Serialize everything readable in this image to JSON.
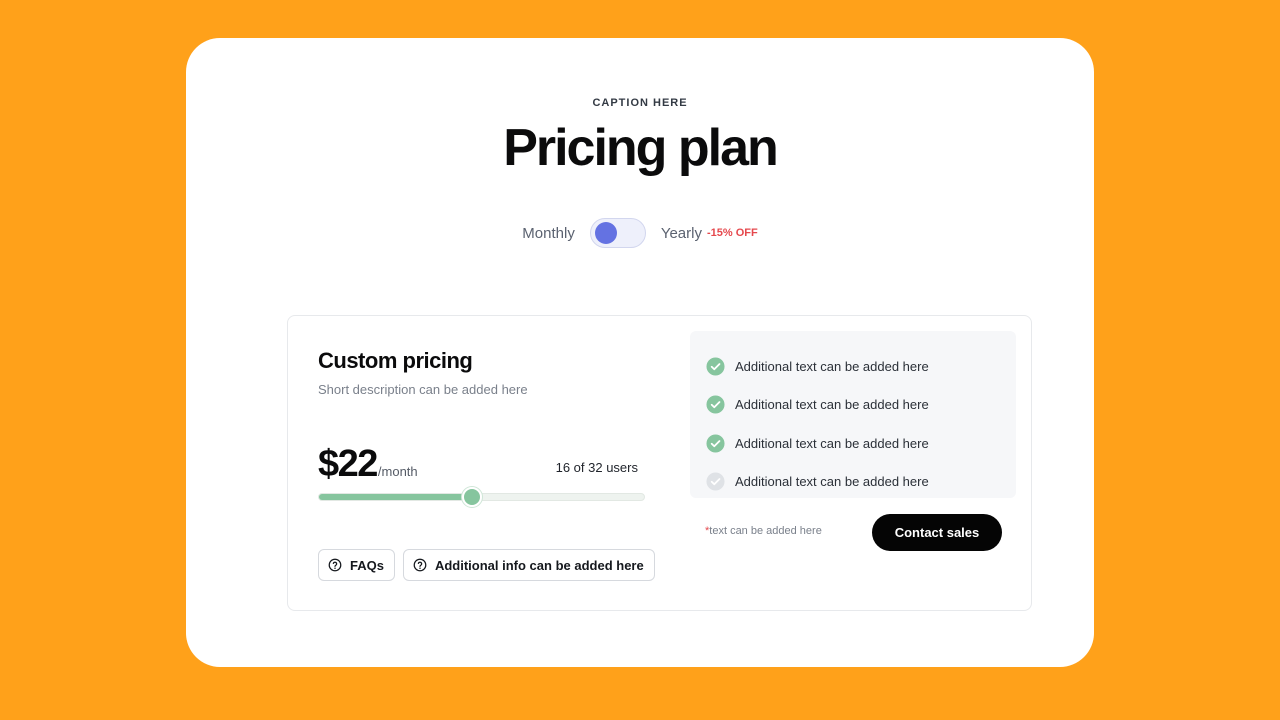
{
  "header": {
    "caption": "CAPTION HERE",
    "title": "Pricing plan"
  },
  "billing_toggle": {
    "monthly_label": "Monthly",
    "yearly_label": "Yearly",
    "discount": "-15% OFF",
    "state": "monthly"
  },
  "plan": {
    "name": "Custom pricing",
    "description": "Short description can be added here",
    "price": "$22",
    "period": "/month",
    "users_label": "16 of 32 users",
    "users_current": 16,
    "users_max": 32,
    "slider_fraction": 0.47
  },
  "buttons": {
    "faqs": "FAQs",
    "additional_info": "Additional info can be added here",
    "contact": "Contact sales"
  },
  "features": [
    {
      "text": "Additional text can be added here",
      "included": true
    },
    {
      "text": "Additional text can be added here",
      "included": true
    },
    {
      "text": "Additional text can be added here",
      "included": true
    },
    {
      "text": "Additional text can be added here",
      "included": false
    }
  ],
  "footnote": {
    "asterisk": "*",
    "text": "text can be added here"
  },
  "colors": {
    "background": "#FFA11A",
    "accent_toggle": "#6472e2",
    "check_included": "#86c59e",
    "check_excluded": "#dfe2e6",
    "discount": "#e5484d",
    "cta": "#050505"
  },
  "icons": {
    "help": "question-circle-icon",
    "check": "check-circle-icon"
  }
}
